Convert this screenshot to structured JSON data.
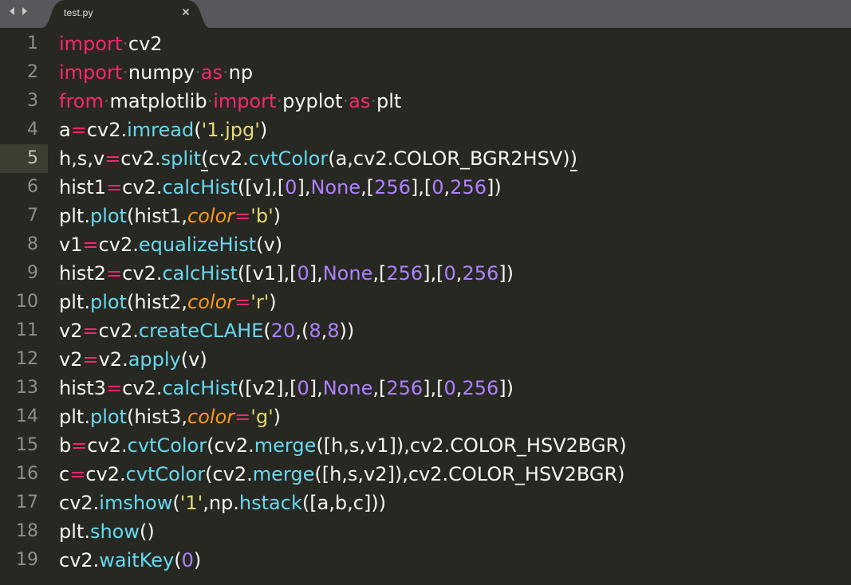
{
  "tab": {
    "filename": "test.py",
    "close_glyph": "×",
    "icons": {
      "back": "triangle-left-icon",
      "forward": "triangle-right-icon",
      "close": "close-icon"
    }
  },
  "editor": {
    "current_line": 5,
    "theme_colors": {
      "background": "#272822",
      "foreground": "#f8f8f2",
      "keyword": "#f92672",
      "function": "#66d9ef",
      "string": "#e6db74",
      "number": "#ae81ff",
      "parameter": "#fd971f",
      "gutter_text": "#8f908a",
      "tab_bar": "#57585b"
    },
    "lines": [
      {
        "no": "1",
        "tokens": [
          [
            "kw",
            "import"
          ],
          [
            "ws",
            "·"
          ],
          [
            "t",
            "cv2"
          ]
        ]
      },
      {
        "no": "2",
        "tokens": [
          [
            "kw",
            "import"
          ],
          [
            "ws",
            "·"
          ],
          [
            "t",
            "numpy"
          ],
          [
            "ws",
            "·"
          ],
          [
            "kw",
            "as"
          ],
          [
            "ws",
            "·"
          ],
          [
            "t",
            "np"
          ]
        ]
      },
      {
        "no": "3",
        "tokens": [
          [
            "kw",
            "from"
          ],
          [
            "ws",
            "·"
          ],
          [
            "t",
            "matplotlib"
          ],
          [
            "ws",
            "·"
          ],
          [
            "kw",
            "import"
          ],
          [
            "ws",
            "·"
          ],
          [
            "t",
            "pyplot"
          ],
          [
            "ws",
            "·"
          ],
          [
            "kw",
            "as"
          ],
          [
            "ws",
            "·"
          ],
          [
            "t",
            "plt"
          ]
        ]
      },
      {
        "no": "4",
        "tokens": [
          [
            "t",
            "a"
          ],
          [
            "op",
            "="
          ],
          [
            "t",
            "cv2."
          ],
          [
            "fn",
            "imread"
          ],
          [
            "t",
            "("
          ],
          [
            "str",
            "'1.jpg'"
          ],
          [
            "t",
            ")"
          ]
        ]
      },
      {
        "no": "5",
        "tokens": [
          [
            "t",
            "h,s,v"
          ],
          [
            "op",
            "="
          ],
          [
            "t",
            "cv2."
          ],
          [
            "fn",
            "split"
          ],
          [
            "bm",
            "("
          ],
          [
            "t",
            "cv2."
          ],
          [
            "fn",
            "cvtColor"
          ],
          [
            "t",
            "(a,cv2.COLOR_BGR2HSV)"
          ],
          [
            "bm",
            ")"
          ]
        ]
      },
      {
        "no": "6",
        "tokens": [
          [
            "t",
            "hist1"
          ],
          [
            "op",
            "="
          ],
          [
            "t",
            "cv2."
          ],
          [
            "fn",
            "calcHist"
          ],
          [
            "t",
            "([v],["
          ],
          [
            "num",
            "0"
          ],
          [
            "t",
            "],"
          ],
          [
            "const",
            "None"
          ],
          [
            "t",
            ",["
          ],
          [
            "num",
            "256"
          ],
          [
            "t",
            "],["
          ],
          [
            "num",
            "0"
          ],
          [
            "t",
            ","
          ],
          [
            "num",
            "256"
          ],
          [
            "t",
            "])"
          ]
        ]
      },
      {
        "no": "7",
        "tokens": [
          [
            "t",
            "plt."
          ],
          [
            "fn",
            "plot"
          ],
          [
            "t",
            "(hist1,"
          ],
          [
            "param",
            "color"
          ],
          [
            "op",
            "="
          ],
          [
            "str",
            "'b'"
          ],
          [
            "t",
            ")"
          ]
        ]
      },
      {
        "no": "8",
        "tokens": [
          [
            "t",
            "v1"
          ],
          [
            "op",
            "="
          ],
          [
            "t",
            "cv2."
          ],
          [
            "fn",
            "equalizeHist"
          ],
          [
            "t",
            "(v)"
          ]
        ]
      },
      {
        "no": "9",
        "tokens": [
          [
            "t",
            "hist2"
          ],
          [
            "op",
            "="
          ],
          [
            "t",
            "cv2."
          ],
          [
            "fn",
            "calcHist"
          ],
          [
            "t",
            "([v1],["
          ],
          [
            "num",
            "0"
          ],
          [
            "t",
            "],"
          ],
          [
            "const",
            "None"
          ],
          [
            "t",
            ",["
          ],
          [
            "num",
            "256"
          ],
          [
            "t",
            "],["
          ],
          [
            "num",
            "0"
          ],
          [
            "t",
            ","
          ],
          [
            "num",
            "256"
          ],
          [
            "t",
            "])"
          ]
        ]
      },
      {
        "no": "10",
        "tokens": [
          [
            "t",
            "plt."
          ],
          [
            "fn",
            "plot"
          ],
          [
            "t",
            "(hist2,"
          ],
          [
            "param",
            "color"
          ],
          [
            "op",
            "="
          ],
          [
            "str",
            "'r'"
          ],
          [
            "t",
            ")"
          ]
        ]
      },
      {
        "no": "11",
        "tokens": [
          [
            "t",
            "v2"
          ],
          [
            "op",
            "="
          ],
          [
            "t",
            "cv2."
          ],
          [
            "fn",
            "createCLAHE"
          ],
          [
            "t",
            "("
          ],
          [
            "num",
            "20"
          ],
          [
            "t",
            ",("
          ],
          [
            "num",
            "8"
          ],
          [
            "t",
            ","
          ],
          [
            "num",
            "8"
          ],
          [
            "t",
            "))"
          ]
        ]
      },
      {
        "no": "12",
        "tokens": [
          [
            "t",
            "v2"
          ],
          [
            "op",
            "="
          ],
          [
            "t",
            "v2."
          ],
          [
            "fn",
            "apply"
          ],
          [
            "t",
            "(v)"
          ]
        ]
      },
      {
        "no": "13",
        "tokens": [
          [
            "t",
            "hist3"
          ],
          [
            "op",
            "="
          ],
          [
            "t",
            "cv2."
          ],
          [
            "fn",
            "calcHist"
          ],
          [
            "t",
            "([v2],["
          ],
          [
            "num",
            "0"
          ],
          [
            "t",
            "],"
          ],
          [
            "const",
            "None"
          ],
          [
            "t",
            ",["
          ],
          [
            "num",
            "256"
          ],
          [
            "t",
            "],["
          ],
          [
            "num",
            "0"
          ],
          [
            "t",
            ","
          ],
          [
            "num",
            "256"
          ],
          [
            "t",
            "])"
          ]
        ]
      },
      {
        "no": "14",
        "tokens": [
          [
            "t",
            "plt."
          ],
          [
            "fn",
            "plot"
          ],
          [
            "t",
            "(hist3,"
          ],
          [
            "param",
            "color"
          ],
          [
            "op",
            "="
          ],
          [
            "str",
            "'g'"
          ],
          [
            "t",
            ")"
          ]
        ]
      },
      {
        "no": "15",
        "tokens": [
          [
            "t",
            "b"
          ],
          [
            "op",
            "="
          ],
          [
            "t",
            "cv2."
          ],
          [
            "fn",
            "cvtColor"
          ],
          [
            "t",
            "(cv2."
          ],
          [
            "fn",
            "merge"
          ],
          [
            "t",
            "([h,s,v1]),cv2.COLOR_HSV2BGR)"
          ]
        ]
      },
      {
        "no": "16",
        "tokens": [
          [
            "t",
            "c"
          ],
          [
            "op",
            "="
          ],
          [
            "t",
            "cv2."
          ],
          [
            "fn",
            "cvtColor"
          ],
          [
            "t",
            "(cv2."
          ],
          [
            "fn",
            "merge"
          ],
          [
            "t",
            "([h,s,v2]),cv2.COLOR_HSV2BGR)"
          ]
        ]
      },
      {
        "no": "17",
        "tokens": [
          [
            "t",
            "cv2."
          ],
          [
            "fn",
            "imshow"
          ],
          [
            "t",
            "("
          ],
          [
            "str",
            "'1'"
          ],
          [
            "t",
            ",np."
          ],
          [
            "fn",
            "hstack"
          ],
          [
            "t",
            "([a,b,c]))"
          ]
        ]
      },
      {
        "no": "18",
        "tokens": [
          [
            "t",
            "plt."
          ],
          [
            "fn",
            "show"
          ],
          [
            "t",
            "()"
          ]
        ]
      },
      {
        "no": "19",
        "tokens": [
          [
            "t",
            "cv2."
          ],
          [
            "fn",
            "waitKey"
          ],
          [
            "t",
            "("
          ],
          [
            "num",
            "0"
          ],
          [
            "t",
            ")"
          ]
        ]
      }
    ]
  }
}
